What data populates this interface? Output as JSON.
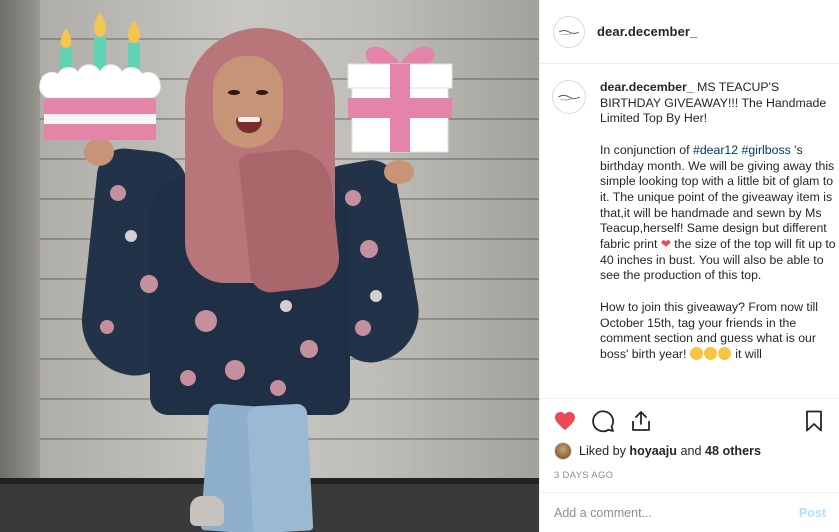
{
  "post": {
    "username": "dear.december_",
    "caption": {
      "username": "dear.december_",
      "headline": "MS TEACUP'S BIRTHDAY GIVEAWAY!!! The Handmade Limited Top By Her!",
      "para2_before": "In conjunction of ",
      "hashtag1": "#dear12",
      "hashtag2": "#girlboss",
      "para2_after": " 's birthday month. We will be giving away this simple looking top with a little bit of glam to it. The unique point of the giveaway item is that,it will be handmade and sewn by Ms Teacup,herself! Same design but different fabric print ",
      "heart": "❤",
      "para2_end": " the size of the top will fit up to 40 inches in bust. You will also be able to see the production of this top.",
      "para3": "How to join this giveaway? From now till October 15th, tag your friends in the comment section and guess what is our boss' birth year! ",
      "para3_end": " it will"
    },
    "likes": {
      "prefix": "Liked by ",
      "user": "hoyaaju",
      "middle": " and ",
      "others": "48 others"
    },
    "timestamp": "3 DAYS AGO",
    "comment_placeholder": "Add a comment...",
    "post_label": "Post"
  },
  "icons": {
    "like": "heart-icon",
    "comment": "comment-icon",
    "share": "share-icon",
    "save": "bookmark-icon"
  },
  "colors": {
    "like_red": "#ed4956",
    "hashtag": "#00376b",
    "muted": "#8e8e8e",
    "post_button": "#b2dffc",
    "cake_pink": "#e384a8",
    "gift_pink": "#e384a8"
  }
}
